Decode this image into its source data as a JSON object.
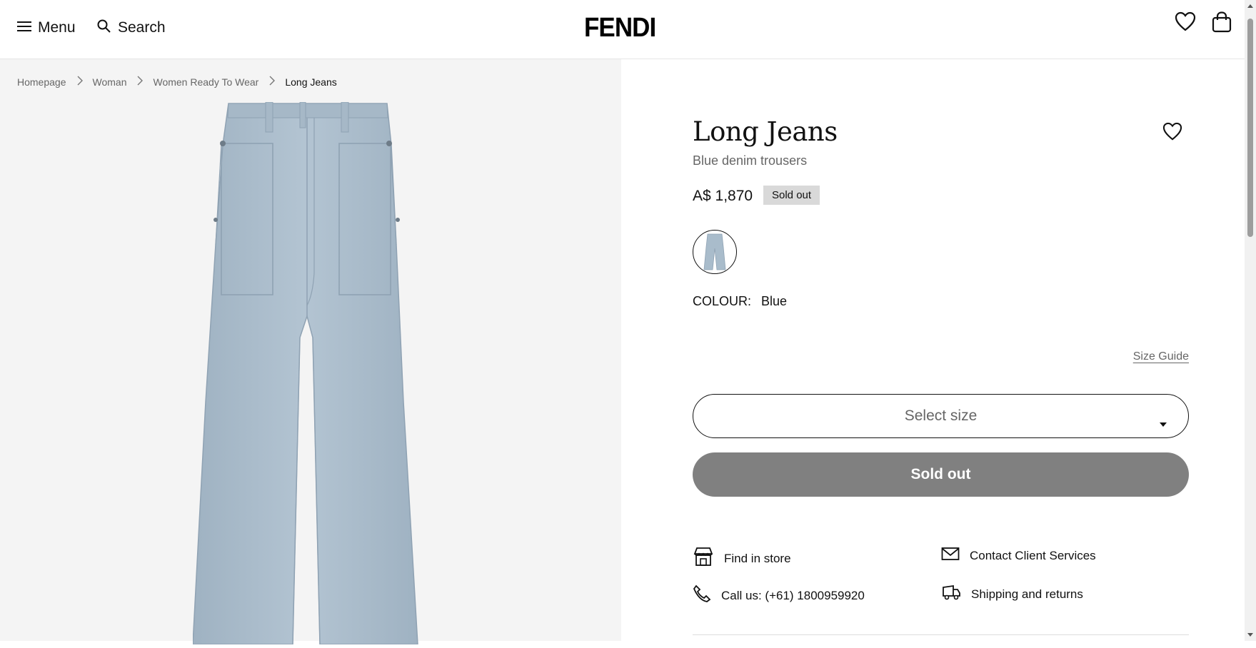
{
  "header": {
    "menu_label": "Menu",
    "search_label": "Search",
    "logo": "FENDI"
  },
  "breadcrumb": {
    "items": [
      "Homepage",
      "Woman",
      "Women Ready To Wear"
    ],
    "current": "Long Jeans"
  },
  "product": {
    "title": "Long Jeans",
    "subtitle": "Blue denim trousers",
    "price": "A$ 1,870",
    "badge": "Sold out",
    "colour_label": "COLOUR:",
    "colour_value": "Blue",
    "size_guide": "Size Guide",
    "size_select_placeholder": "Select size",
    "cta_label": "Sold out",
    "denim_color": "#a9bccb"
  },
  "services": {
    "find_in_store": "Find in store",
    "contact": "Contact Client Services",
    "call": "Call us: (+61) 1800959920",
    "shipping": "Shipping and returns"
  },
  "icons": {
    "menu": "hamburger-icon",
    "search": "search-icon",
    "wishlist": "heart-icon",
    "bag": "shopping-bag-icon",
    "store": "store-icon",
    "mail": "mail-icon",
    "phone": "phone-icon",
    "truck": "truck-icon"
  }
}
